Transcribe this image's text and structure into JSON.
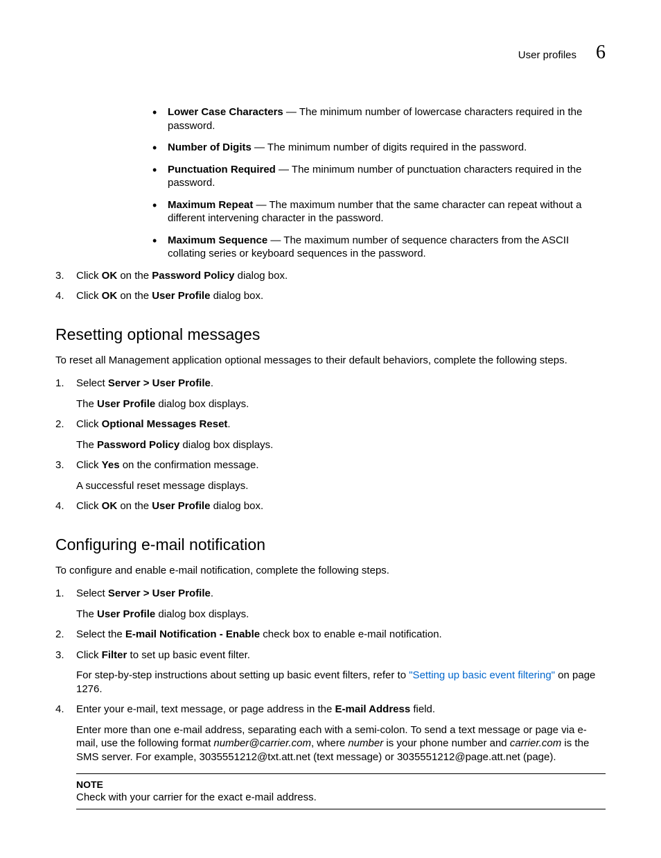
{
  "header": {
    "section": "User profiles",
    "chapter": "6"
  },
  "policy_bullets": [
    {
      "term": "Lower Case Characters",
      "desc": " — The minimum number of lowercase characters required in the password."
    },
    {
      "term": "Number of Digits",
      "desc": " — The minimum number of digits required in the password."
    },
    {
      "term": "Punctuation Required",
      "desc": " — The minimum number of punctuation characters required in the password."
    },
    {
      "term": "Maximum Repeat",
      "desc": " — The maximum number that the same character can repeat without a different intervening character in the password."
    },
    {
      "term": "Maximum Sequence",
      "desc": " — The maximum number of sequence characters from the ASCII collating series or keyboard sequences in the password."
    }
  ],
  "policy_steps": {
    "s3": {
      "pre": "Click ",
      "b1": "OK",
      "mid": " on the ",
      "b2": "Password Policy",
      "post": " dialog box."
    },
    "s4": {
      "pre": "Click ",
      "b1": "OK",
      "mid": " on the ",
      "b2": "User Profile",
      "post": " dialog box."
    }
  },
  "reset": {
    "heading": "Resetting optional messages",
    "intro": "To reset all Management application optional messages to their default behaviors, complete the following steps.",
    "s1": {
      "pre": "Select ",
      "b1": "Server > User Profile",
      "post": ".",
      "sub_pre": "The ",
      "sub_b": "User Profile",
      "sub_post": " dialog box displays."
    },
    "s2": {
      "pre": "Click ",
      "b1": "Optional Messages Reset",
      "post": ".",
      "sub_pre": "The ",
      "sub_b": "Password Policy",
      "sub_post": " dialog box displays."
    },
    "s3": {
      "pre": "Click ",
      "b1": "Yes",
      "post": " on the confirmation message.",
      "sub": "A successful reset message displays."
    },
    "s4": {
      "pre": "Click ",
      "b1": "OK",
      "mid": " on the ",
      "b2": "User Profile",
      "post": " dialog box."
    }
  },
  "email": {
    "heading": "Configuring e-mail notification",
    "intro": "To configure and enable e-mail notification, complete the following steps.",
    "s1": {
      "pre": "Select ",
      "b1": "Server > User Profile",
      "post": ".",
      "sub_pre": "The ",
      "sub_b": "User Profile",
      "sub_post": " dialog box displays."
    },
    "s2": {
      "pre": "Select the ",
      "b1": "E-mail Notification - Enable",
      "post": " check box to enable e-mail notification."
    },
    "s3": {
      "pre": "Click ",
      "b1": "Filter",
      "post": " to set up basic event filter.",
      "sub_pre": "For step-by-step instructions about setting up basic event filters, refer to ",
      "link": "\"Setting up basic event filtering\"",
      "sub_post": " on page 1276."
    },
    "s4": {
      "pre": "Enter your e-mail, text message, or page address in the ",
      "b1": "E-mail Address",
      "post": " field.",
      "p2a": "Enter more than one e-mail address, separating each with a semi-colon. To send a text message or page via e-mail, use the following format ",
      "p2i1": "number@carrier.com",
      "p2b": ", where ",
      "p2i2": "number",
      "p2c": " is your phone number and ",
      "p2i3": "carrier.com",
      "p2d": " is the SMS server. For example, 3035551212@txt.att.net (text message) or 3035551212@page.att.net (page)."
    }
  },
  "note": {
    "label": "NOTE",
    "body": "Check with your carrier for the exact e-mail address."
  }
}
